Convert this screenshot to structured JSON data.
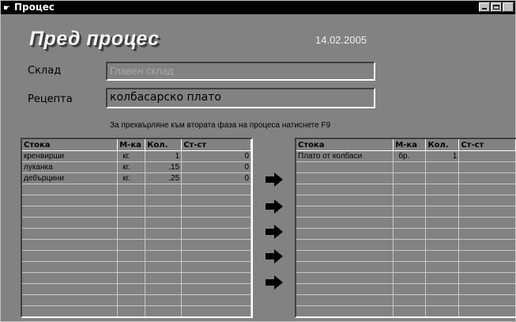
{
  "window": {
    "title": "Процес"
  },
  "header": {
    "title": "Пред процес",
    "date": "14.02.2005"
  },
  "form": {
    "warehouse_label": "Склад",
    "warehouse_value": "Главен склад",
    "recipe_label": "Рецепта",
    "recipe_value": "колбасарско плато",
    "hint": "За прехвърляне към втората фаза на процеса натиснете F9"
  },
  "left_grid": {
    "columns": [
      "Стока",
      "М-ка",
      "Кол.",
      "Ст-ст"
    ],
    "rows": [
      {
        "item": "кренвирши",
        "unit": "кг.",
        "qty": "1",
        "cost": "0"
      },
      {
        "item": "луканка",
        "unit": "кг.",
        "qty": ".15",
        "cost": "0"
      },
      {
        "item": "дебърцини",
        "unit": "кг.",
        "qty": ".25",
        "cost": "0"
      }
    ]
  },
  "right_grid": {
    "columns": [
      "Стока",
      "М-ка",
      "Кол.",
      "Ст-ст"
    ],
    "rows": [
      {
        "item": "Плато от колбаси",
        "unit": "бр.",
        "qty": "1",
        "cost": ""
      }
    ]
  },
  "icons": {
    "arrows": [
      "arrow-right-icon",
      "arrow-right-icon",
      "arrow-right-icon",
      "arrow-right-icon",
      "arrow-right-icon"
    ]
  }
}
